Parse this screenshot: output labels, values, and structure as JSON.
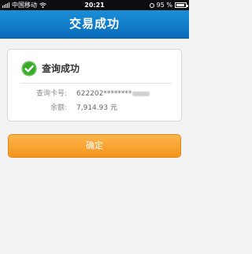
{
  "status_bar": {
    "carrier": "中国移动",
    "time": "20:21",
    "battery_percent": "95 %"
  },
  "nav": {
    "title": "交易成功"
  },
  "result": {
    "title": "查询成功",
    "card_label": "查询卡号:",
    "card_number": "622202********",
    "balance_label": "余额:",
    "balance_value": "7,914.93 元"
  },
  "actions": {
    "confirm_label": "确定"
  },
  "colors": {
    "nav_background": "#0a6cbb",
    "button_background": "#f5951c",
    "success_green": "#3aaa2c"
  },
  "icons": [
    "signal-icon",
    "wifi-icon",
    "clock-icon",
    "battery-icon",
    "check-circle-icon"
  ]
}
